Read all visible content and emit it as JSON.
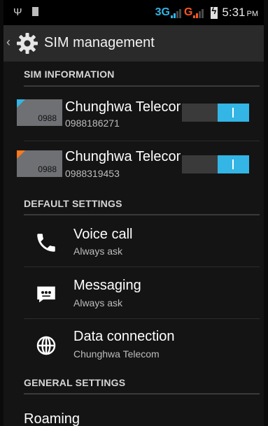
{
  "status_bar": {
    "network1": "3G",
    "network2": "G",
    "time": "5:31",
    "ampm": "PM",
    "colors": {
      "sim1": "#33b5e5",
      "sim2": "#ff5722"
    }
  },
  "action_bar": {
    "title": "SIM management",
    "icon": "settings-gear-icon"
  },
  "sections": {
    "sim_information": "SIM INFORMATION",
    "default_settings": "DEFAULT SETTINGS",
    "general_settings": "GENERAL SETTINGS"
  },
  "sims": [
    {
      "card_label": "0988",
      "name": "Chunghwa Telecom",
      "number": "0988186271",
      "accent": "#33b5e5",
      "enabled": true
    },
    {
      "card_label": "0988",
      "name": "Chunghwa Telecom",
      "number": "0988319453",
      "accent": "#ff7a1a",
      "enabled": true
    }
  ],
  "default_settings": [
    {
      "title": "Voice call",
      "subtitle": "Always ask",
      "icon": "phone-icon"
    },
    {
      "title": "Messaging",
      "subtitle": "Always ask",
      "icon": "message-icon"
    },
    {
      "title": "Data connection",
      "subtitle": "Chunghwa Telecom",
      "icon": "globe-icon"
    }
  ],
  "general_settings": [
    {
      "title": "Roaming"
    }
  ]
}
